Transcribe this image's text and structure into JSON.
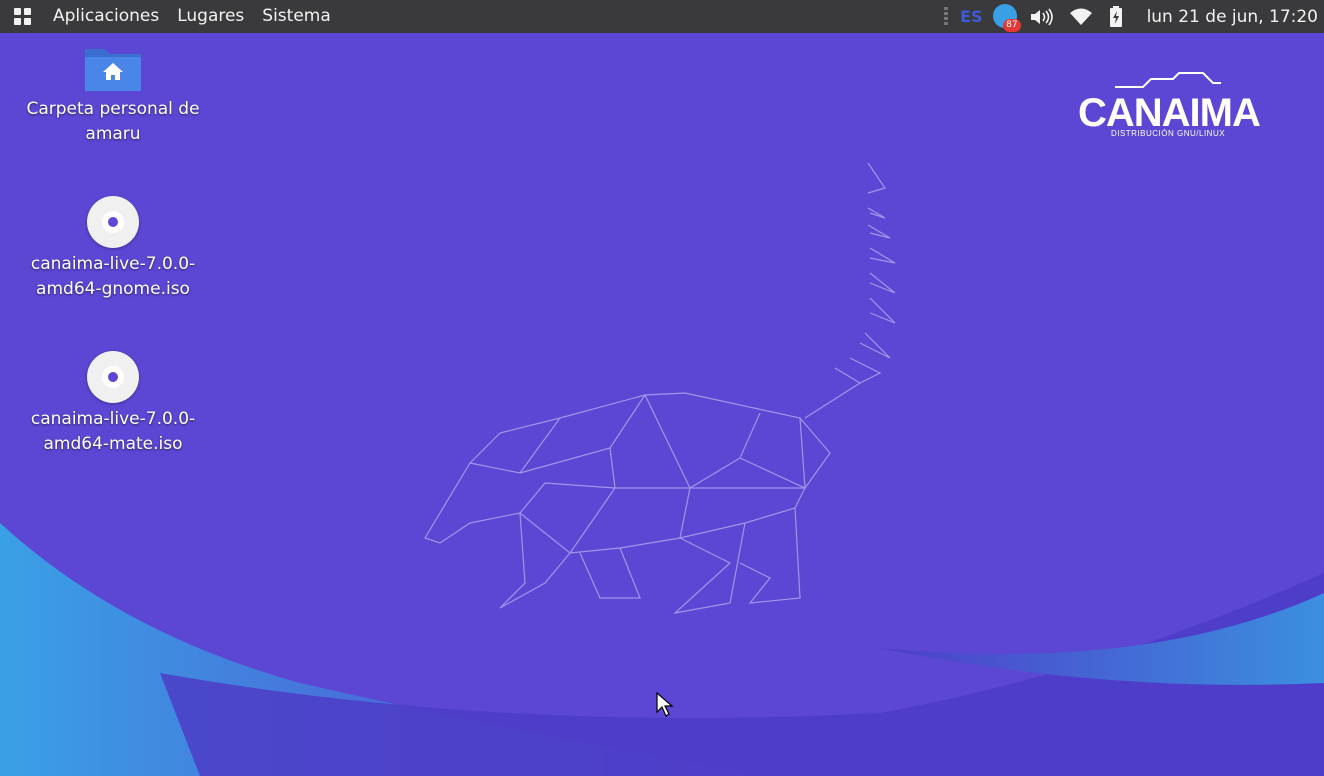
{
  "panel": {
    "menus": [
      "Aplicaciones",
      "Lugares",
      "Sistema"
    ],
    "keyboard_layout": "ES",
    "notification_badge": "87",
    "clock": "lun 21 de jun, 17:20",
    "icons": [
      "apps-grid-icon",
      "notification-icon",
      "volume-icon",
      "wifi-icon",
      "battery-icon"
    ]
  },
  "desktop": {
    "icons": [
      {
        "label": "Carpeta personal de amaru",
        "icon": "home-folder-icon"
      },
      {
        "label": "canaima-live-7.0.0-amd64-gnome.iso",
        "icon": "disc-icon"
      },
      {
        "label": "canaima-live-7.0.0-amd64-mate.iso",
        "icon": "disc-icon"
      }
    ]
  },
  "logo": {
    "name": "CANAIMA",
    "tagline": "DISTRIBUCIÓN GNU/LINUX"
  },
  "colors": {
    "background": "#5b47d3",
    "panel": "#3a3a3c",
    "wave_light": "#3aa0e6",
    "wave_dark": "#4a3cc4"
  }
}
